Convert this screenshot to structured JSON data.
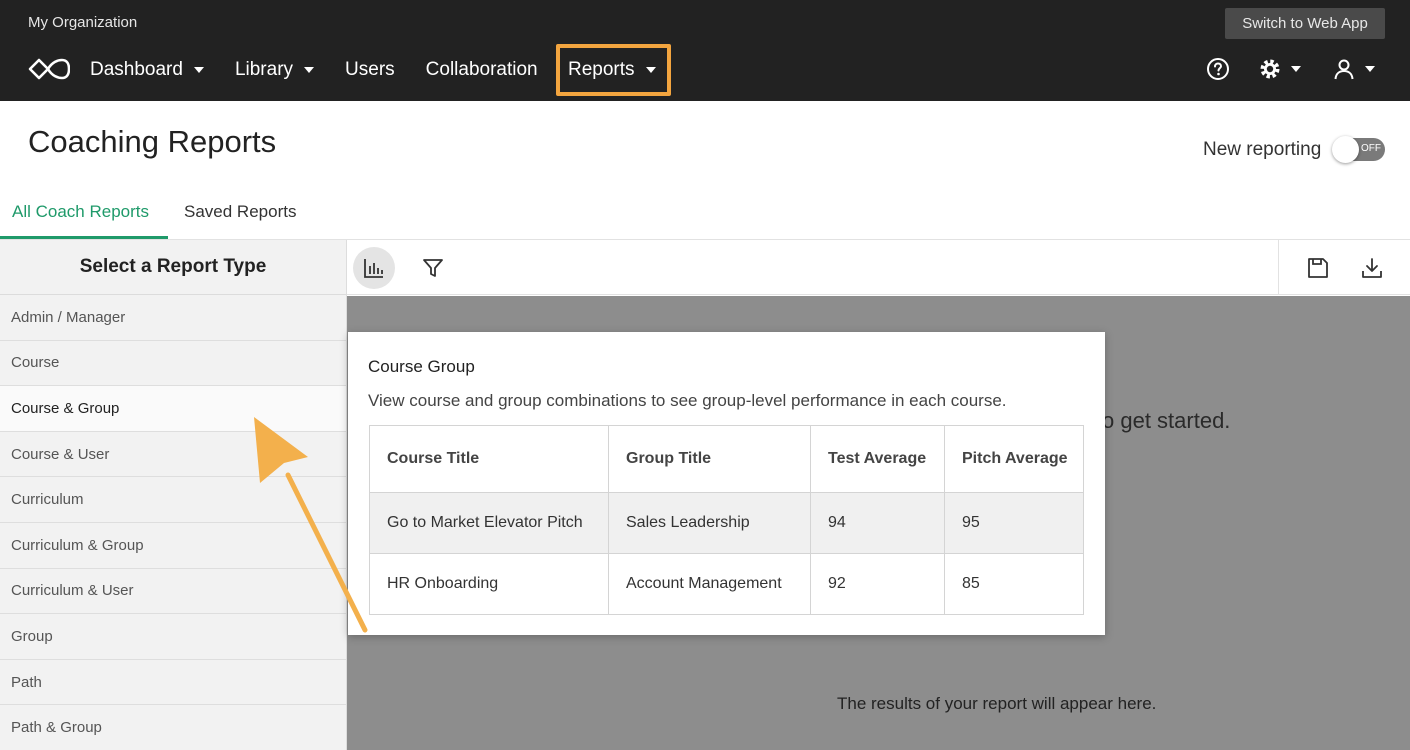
{
  "topbar": {
    "org_name": "My Organization",
    "switch_label": "Switch to Web App",
    "nav": [
      {
        "label": "Dashboard"
      },
      {
        "label": "Library"
      },
      {
        "label": "Users"
      },
      {
        "label": "Collaboration"
      },
      {
        "label": "Reports"
      }
    ],
    "highlight_color": "#f3a53f",
    "icons": [
      "logo-icon",
      "help-icon",
      "gear-icon",
      "user-icon"
    ]
  },
  "header": {
    "title": "Coaching Reports",
    "toggle_label": "New reporting",
    "toggle_state": "OFF"
  },
  "tabs": [
    {
      "label": "All Coach Reports",
      "active": true
    },
    {
      "label": "Saved Reports",
      "active": false
    }
  ],
  "accent_color": "#1f9a6a",
  "sidebar": {
    "heading": "Select a Report Type",
    "items": [
      {
        "label": "Admin / Manager"
      },
      {
        "label": "Course"
      },
      {
        "label": "Course & Group",
        "selected": true
      },
      {
        "label": "Course & User"
      },
      {
        "label": "Curriculum"
      },
      {
        "label": "Curriculum & Group"
      },
      {
        "label": "Curriculum & User"
      },
      {
        "label": "Group"
      },
      {
        "label": "Path"
      },
      {
        "label": "Path & Group"
      }
    ]
  },
  "toolbar": {
    "icons": [
      "bar-chart-icon",
      "filter-icon",
      "save-icon",
      "download-icon"
    ]
  },
  "main": {
    "started_text": "o get started.",
    "results_text": "The results of your report will appear here."
  },
  "popover": {
    "title": "Course Group",
    "description": "View course and group combinations to see group-level performance in each course.",
    "columns": [
      "Course Title",
      "Group Title",
      "Test Average",
      "Pitch Average"
    ],
    "rows": [
      [
        "Go to Market Elevator Pitch",
        "Sales Leadership",
        "94",
        "95"
      ],
      [
        "HR Onboarding",
        "Account Management",
        "92",
        "85"
      ]
    ]
  }
}
